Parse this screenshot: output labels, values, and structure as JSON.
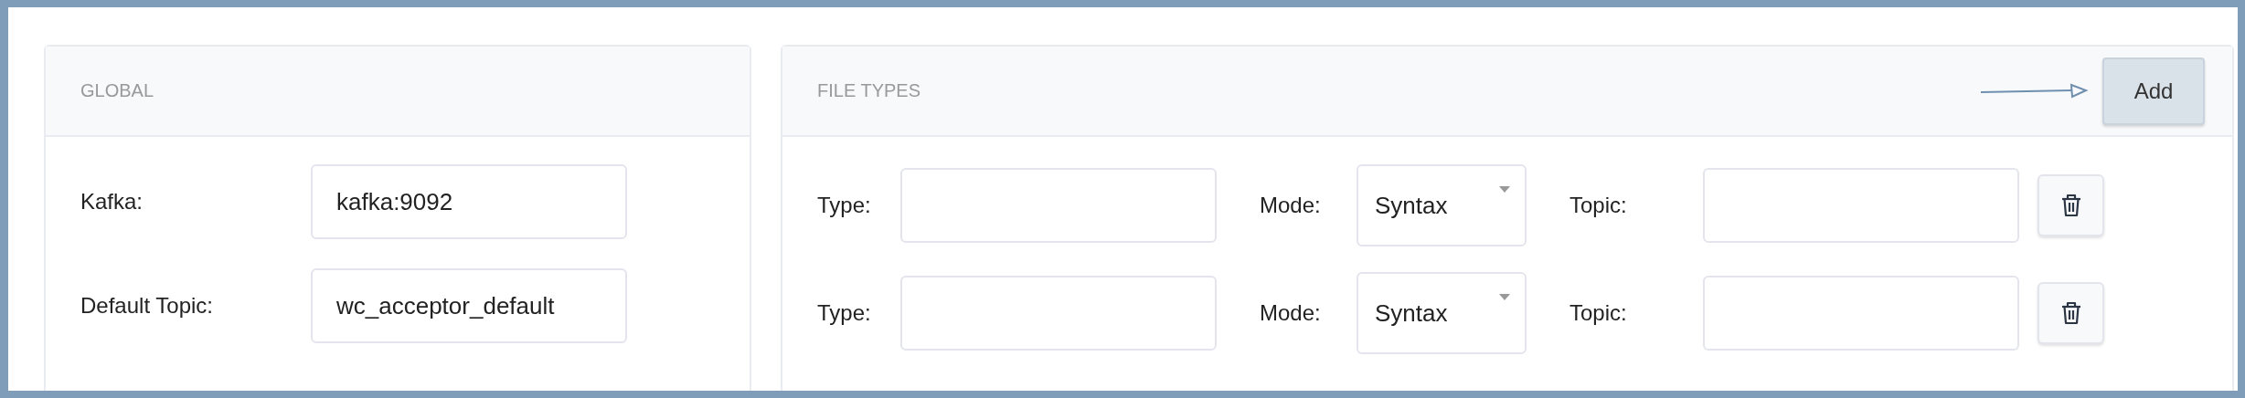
{
  "global": {
    "title": "GLOBAL",
    "fields": [
      {
        "label": "Kafka:",
        "value": "kafka:9092"
      },
      {
        "label": "Default Topic:",
        "value": "wc_acceptor_default"
      }
    ]
  },
  "file_types": {
    "title": "FILE TYPES",
    "add_button": "Add",
    "rows": [
      {
        "type_label": "Type:",
        "mode_label": "Mode:",
        "mode": "Syntax",
        "topic_label": "Topic:"
      },
      {
        "type_label": "Type:",
        "mode_label": "Mode:",
        "mode": "Syntax",
        "topic_label": "Topic:"
      }
    ]
  }
}
